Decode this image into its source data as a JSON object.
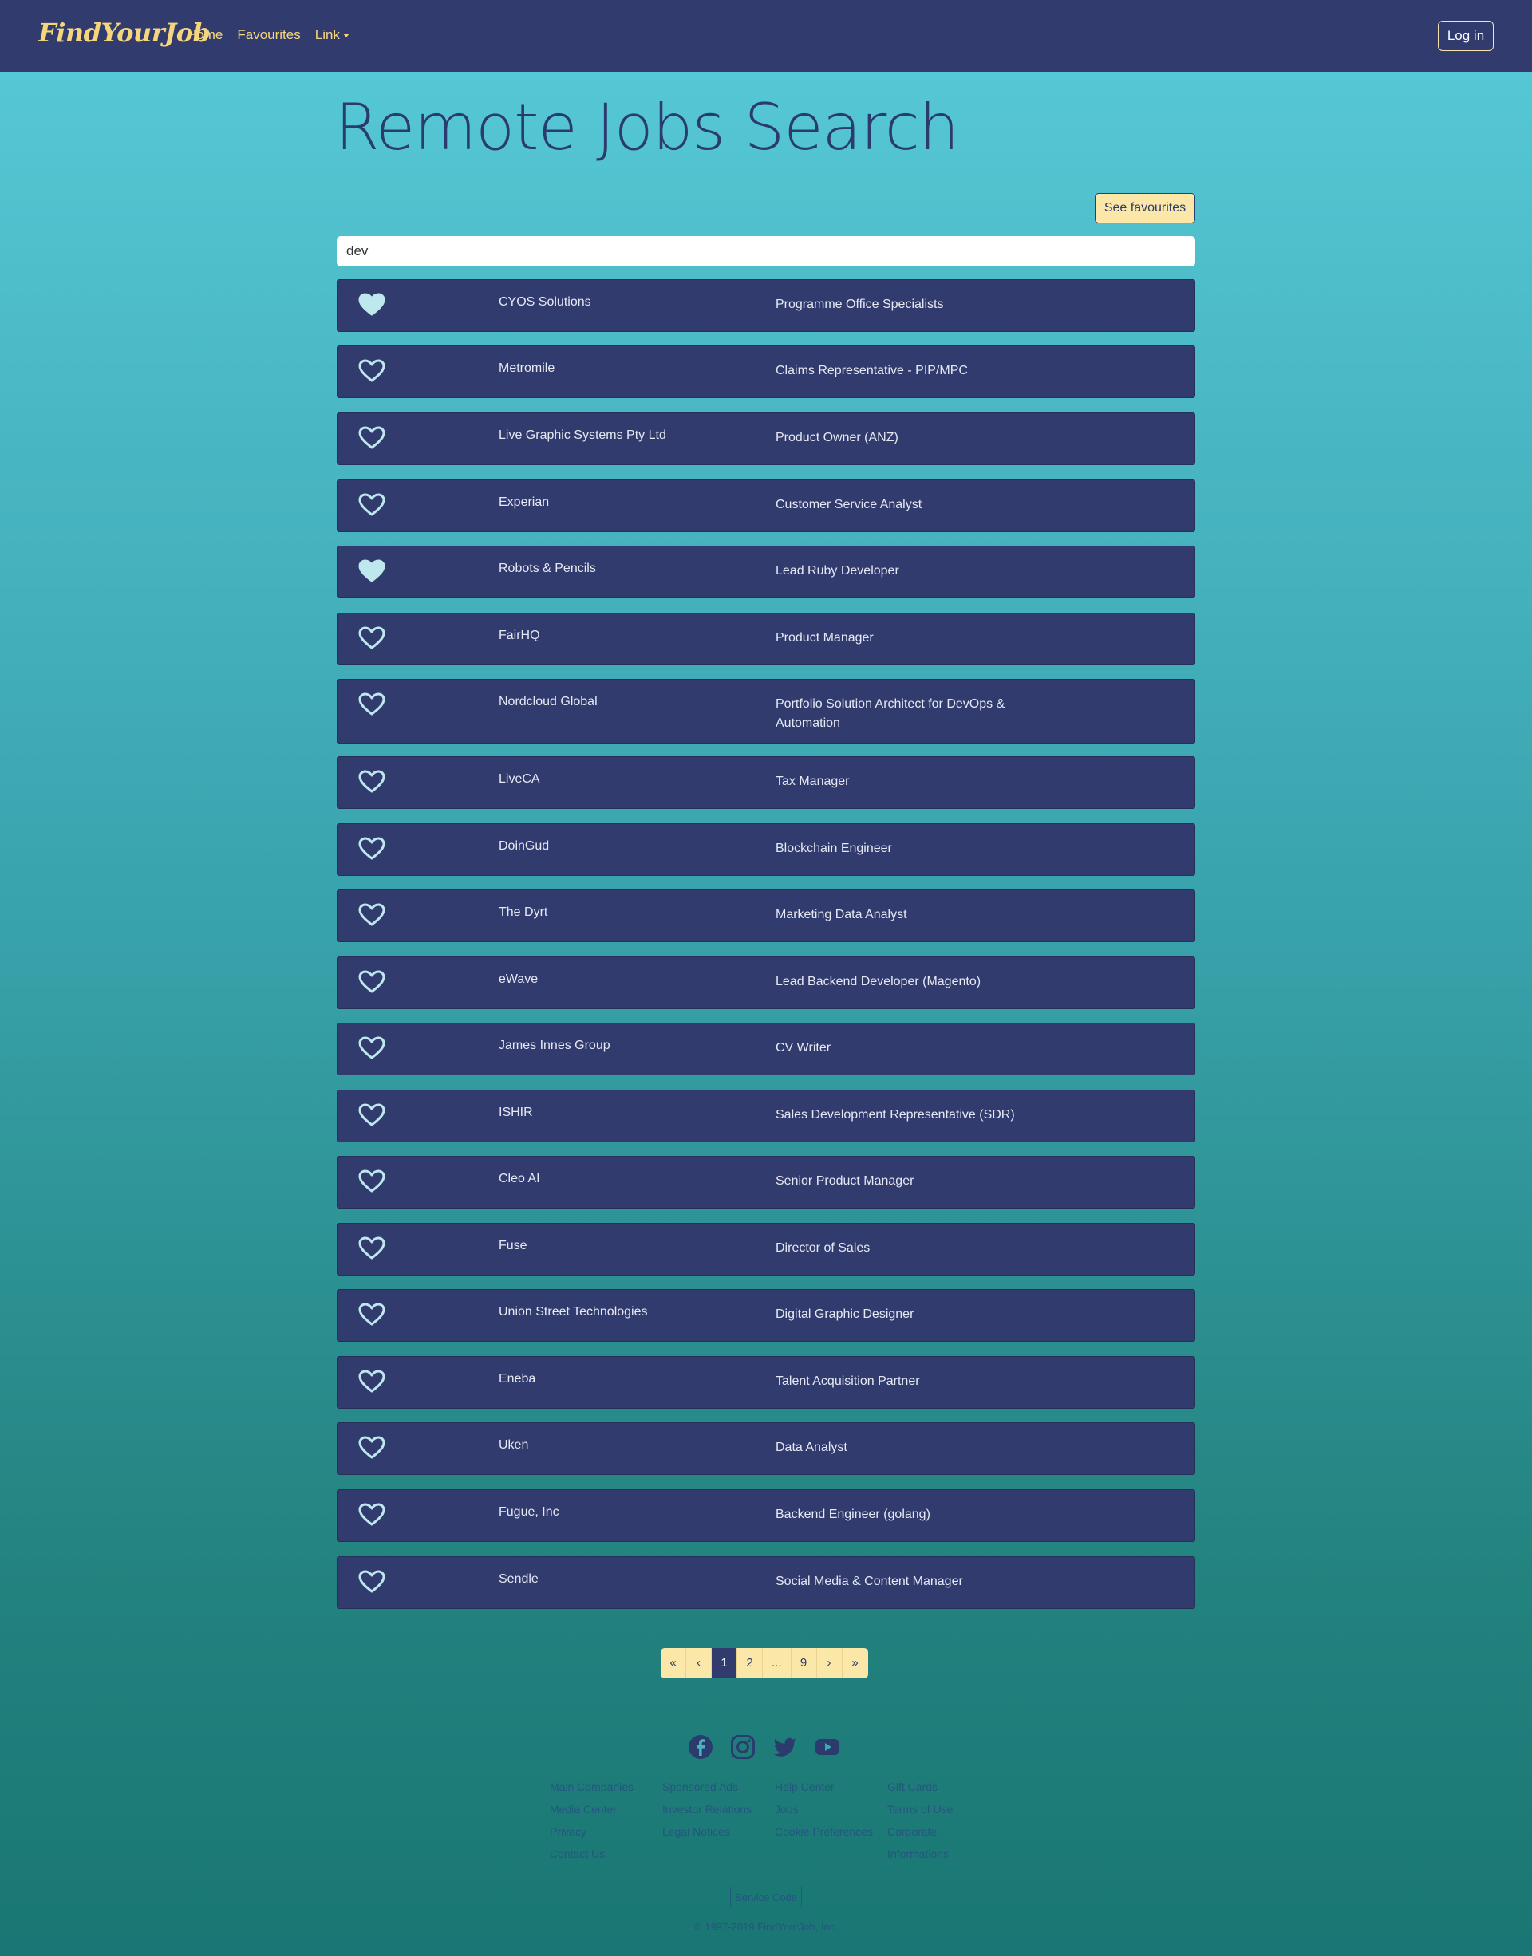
{
  "navbar": {
    "brand": "FindYourJob",
    "links": [
      "Home",
      "Favourites",
      "Link"
    ],
    "login": "Log in"
  },
  "page": {
    "title": "Remote Jobs Search",
    "see_favourites": "See favourites"
  },
  "search": {
    "value": "dev"
  },
  "jobs": [
    {
      "company": "CYOS Solutions",
      "title": "Programme Office Specialists",
      "favourite": true
    },
    {
      "company": "Metromile",
      "title": "Claims Representative - PIP/MPC",
      "favourite": false
    },
    {
      "company": "Live Graphic Systems Pty Ltd",
      "title": "Product Owner (ANZ)",
      "favourite": false
    },
    {
      "company": "Experian",
      "title": "Customer Service Analyst",
      "favourite": false
    },
    {
      "company": "Robots & Pencils",
      "title": "Lead Ruby Developer",
      "favourite": true
    },
    {
      "company": "FairHQ",
      "title": "Product Manager",
      "favourite": false
    },
    {
      "company": "Nordcloud Global",
      "title": "Portfolio Solution Architect for DevOps & Automation",
      "favourite": false
    },
    {
      "company": "LiveCA",
      "title": "Tax Manager",
      "favourite": false
    },
    {
      "company": "DoinGud",
      "title": "Blockchain Engineer",
      "favourite": false
    },
    {
      "company": "The Dyrt",
      "title": "Marketing Data Analyst",
      "favourite": false
    },
    {
      "company": "eWave",
      "title": "Lead Backend Developer (Magento)",
      "favourite": false
    },
    {
      "company": "James Innes Group",
      "title": "CV Writer",
      "favourite": false
    },
    {
      "company": "ISHIR",
      "title": "Sales Development Representative (SDR)",
      "favourite": false
    },
    {
      "company": "Cleo AI",
      "title": "Senior Product Manager",
      "favourite": false
    },
    {
      "company": "Fuse",
      "title": "Director of Sales",
      "favourite": false
    },
    {
      "company": "Union Street Technologies",
      "title": "Digital Graphic Designer",
      "favourite": false
    },
    {
      "company": "Eneba",
      "title": "Talent Acquisition Partner",
      "favourite": false
    },
    {
      "company": "Uken",
      "title": "Data Analyst",
      "favourite": false
    },
    {
      "company": "Fugue, Inc",
      "title": "Backend Engineer (golang)",
      "favourite": false
    },
    {
      "company": "Sendle",
      "title": "Social Media & Content Manager",
      "favourite": false
    }
  ],
  "pagination": {
    "items": [
      "«",
      "‹",
      "1",
      "2",
      "...",
      "9",
      "›",
      "»"
    ],
    "current": "1"
  },
  "footer": {
    "social": [
      "facebook-icon",
      "instagram-icon",
      "twitter-icon",
      "youtube-icon"
    ],
    "columns": [
      [
        "Main Companies",
        "Media Center",
        "Privacy",
        "Contact Us"
      ],
      [
        "Sponsored Ads",
        "Investor Relations",
        "Legal Notices"
      ],
      [
        "Help Center",
        "Jobs",
        "Cookie Preferences"
      ],
      [
        "Gift Cards",
        "Terms of Use",
        "Corporate",
        "Informations"
      ]
    ],
    "service_code": "Service Code",
    "copyright": "© 1997-2019 FindYourJob, Inc."
  },
  "colors": {
    "navbar": "#313b6d",
    "brand": "#f6d67c",
    "row": "#313b6d",
    "heart": "#bfe7ee",
    "button": "#fbe7a8"
  }
}
